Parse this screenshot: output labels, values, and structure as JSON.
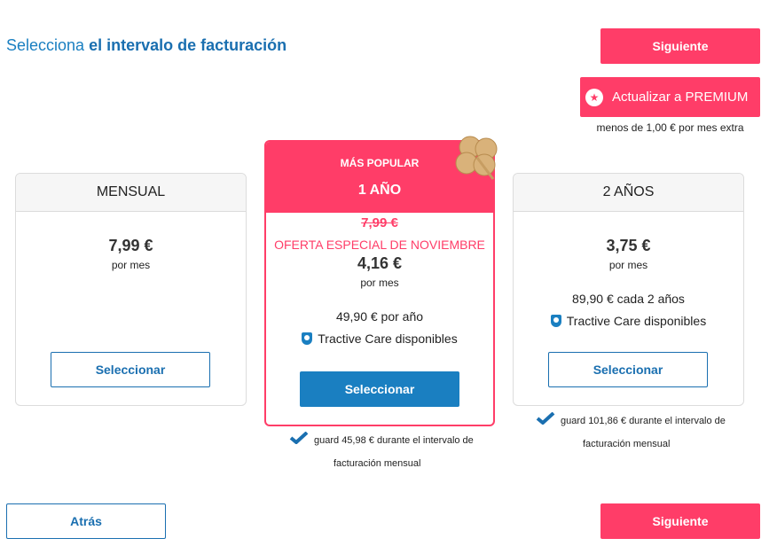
{
  "header": {
    "title_prefix": "Selecciona",
    "title_bold": "el intervalo de facturación",
    "next_label": "Siguiente"
  },
  "premium": {
    "label": "Actualizar a PREMIUM",
    "note": "menos de 1,00 € por mes extra",
    "icon": "star-icon"
  },
  "plans": {
    "monthly": {
      "name": "MENSUAL",
      "price": "7,99 €",
      "per": "por mes",
      "button": "Seleccionar"
    },
    "yearly": {
      "badge": "MÁS POPULAR",
      "name": "1 AÑO",
      "old_price": "7,99 €",
      "offer": "OFERTA ESPECIAL DE NOVIEMBRE",
      "price": "4,16 €",
      "per": "por mes",
      "total": "49,90 € por año",
      "care": "Tractive Care disponibles",
      "button": "Seleccionar",
      "savings_line1": "guard 45,98 € durante el intervalo de",
      "savings_line2": "facturación mensual"
    },
    "two_years": {
      "name": "2 AÑOS",
      "price": "3,75 €",
      "per": "por mes",
      "total": "89,90 € cada 2 años",
      "care": "Tractive Care disponibles",
      "button": "Seleccionar",
      "savings_line1": "guard 101,86 € durante el intervalo de",
      "savings_line2": "facturación mensual"
    }
  },
  "footer": {
    "back_label": "Atrás",
    "next_label": "Siguiente"
  },
  "colors": {
    "accent": "#ff3d68",
    "primary_blue": "#1a7fc1"
  }
}
